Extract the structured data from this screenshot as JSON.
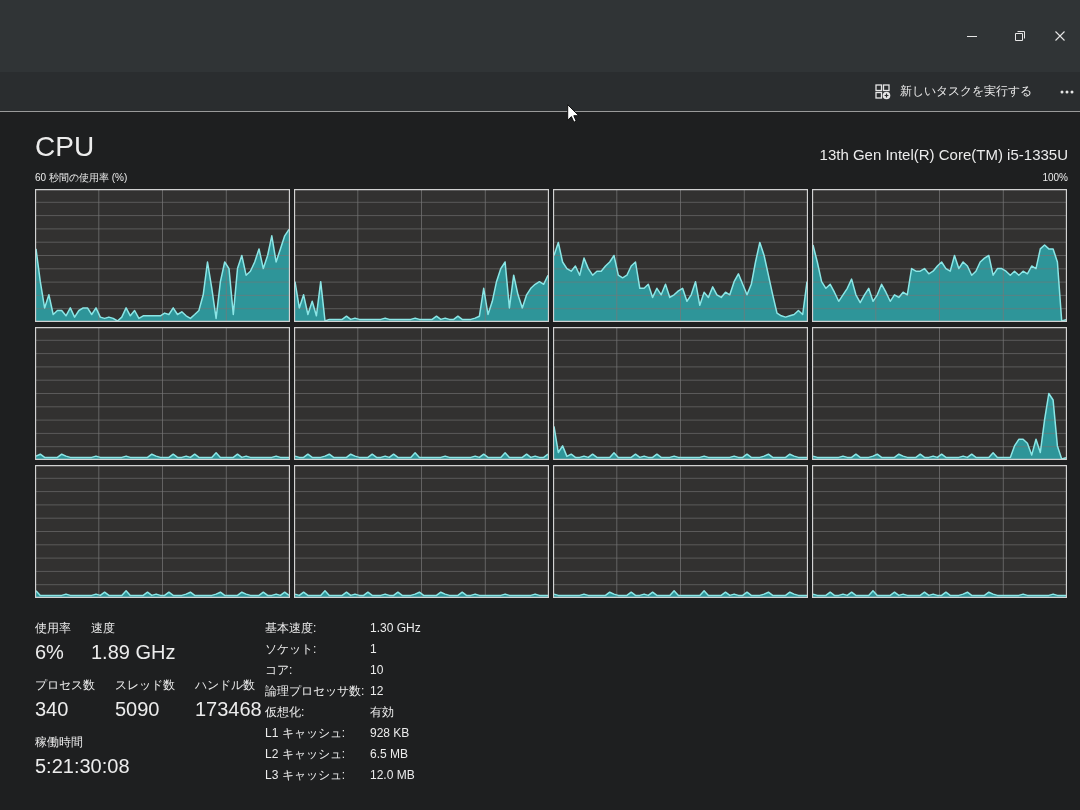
{
  "command_bar": {
    "run_task_button": "新しいタスクを実行する"
  },
  "header": {
    "title": "CPU",
    "processor_name": "13th Gen Intel(R) Core(TM) i5-1335U"
  },
  "graph_panel": {
    "caption": "60 秒間の使用率 (%)",
    "max_label": "100%"
  },
  "stat_rows": [
    {
      "items": [
        {
          "label": "使用率",
          "value": "6%"
        },
        {
          "label": "速度",
          "value": "1.89 GHz"
        }
      ]
    },
    {
      "items": [
        {
          "label": "プロセス数",
          "value": "340"
        },
        {
          "label": "スレッド数",
          "value": "5090"
        },
        {
          "label": "ハンドル数",
          "value": "173468"
        }
      ]
    },
    {
      "items": [
        {
          "label": "稼働時間",
          "value": "5:21:30:08"
        }
      ]
    }
  ],
  "details": [
    {
      "label": "基本速度:",
      "value": "1.30 GHz"
    },
    {
      "label": "ソケット:",
      "value": "1"
    },
    {
      "label": "コア:",
      "value": "10"
    },
    {
      "label": "論理プロセッサ数:",
      "value": "12"
    },
    {
      "label": "仮想化:",
      "value": "有効"
    },
    {
      "label": "L1 キャッシュ:",
      "value": "928 KB"
    },
    {
      "label": "L2 キャッシュ:",
      "value": "6.5 MB"
    },
    {
      "label": "L3 キャッシュ:",
      "value": "12.0 MB"
    }
  ]
}
